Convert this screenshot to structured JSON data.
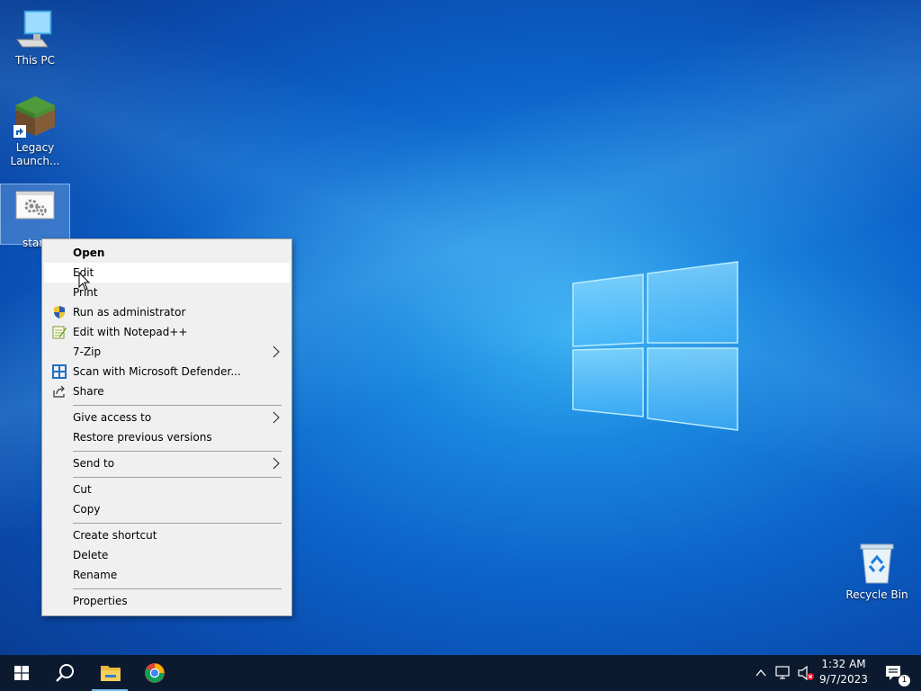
{
  "desktop": {
    "icons": [
      {
        "label": "This PC",
        "icon": "this-pc-icon"
      },
      {
        "label": "Legacy Launch...",
        "line1": "Legacy",
        "line2": "Launch...",
        "icon": "minecraft-grass-block-icon"
      },
      {
        "label": "start",
        "icon": "batch-file-gears-icon"
      },
      {
        "label": "Recycle Bin",
        "icon": "recycle-bin-icon"
      }
    ]
  },
  "context_menu": {
    "items": [
      {
        "label": "Open",
        "bold": true
      },
      {
        "label": "Edit",
        "hovered": true
      },
      {
        "label": "Print"
      },
      {
        "label": "Run as administrator",
        "icon": "uac-shield-icon"
      },
      {
        "label": "Edit with Notepad++",
        "icon": "notepad-plus-plus-icon"
      },
      {
        "label": "7-Zip",
        "submenu": true
      },
      {
        "label": "Scan with Microsoft Defender...",
        "icon": "defender-icon"
      },
      {
        "label": "Share",
        "icon": "share-icon"
      },
      {
        "label": "Give access to",
        "submenu": true
      },
      {
        "label": "Restore previous versions"
      },
      {
        "label": "Send to",
        "submenu": true
      },
      {
        "label": "Cut"
      },
      {
        "label": "Copy"
      },
      {
        "label": "Create shortcut"
      },
      {
        "label": "Delete"
      },
      {
        "label": "Rename"
      },
      {
        "label": "Properties"
      }
    ]
  },
  "taskbar": {
    "pinned": [
      "start-button",
      "search-button",
      "file-explorer",
      "google-chrome"
    ],
    "clock": {
      "time": "1:32 AM",
      "date": "9/7/2023"
    },
    "notification_count": "1"
  },
  "colors": {
    "accent": "#0a63c9",
    "taskbar": "#0b1a2e",
    "menu_bg": "#f0f0f0",
    "menu_hover": "#ffffff"
  }
}
